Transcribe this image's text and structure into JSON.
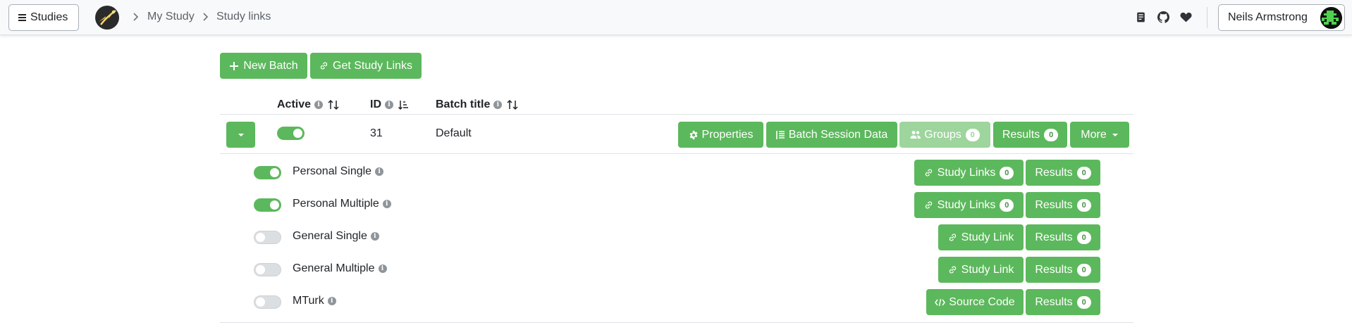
{
  "navbar": {
    "studies_label": "Studies",
    "breadcrumb": [
      "My Study",
      "Study links"
    ],
    "user_name": "Neils Armstrong"
  },
  "toolbar": {
    "new_batch_label": "New Batch",
    "get_study_links_label": "Get Study Links"
  },
  "table": {
    "headers": {
      "active": "Active",
      "id": "ID",
      "title": "Batch title"
    },
    "batch": {
      "active": true,
      "id": "31",
      "title": "Default",
      "properties_label": "Properties",
      "session_data_label": "Batch Session Data",
      "groups_label": "Groups",
      "groups_count": "0",
      "results_label": "Results",
      "results_count": "0",
      "more_label": "More"
    },
    "link_types": [
      {
        "name": "Personal Single",
        "active": true,
        "action_label": "Study Links",
        "action_count": "0",
        "results_label": "Results",
        "results_count": "0"
      },
      {
        "name": "Personal Multiple",
        "active": true,
        "action_label": "Study Links",
        "action_count": "0",
        "results_label": "Results",
        "results_count": "0"
      },
      {
        "name": "General Single",
        "active": false,
        "action_label": "Study Link",
        "results_label": "Results",
        "results_count": "0"
      },
      {
        "name": "General Multiple",
        "active": false,
        "action_label": "Study Link",
        "results_label": "Results",
        "results_count": "0"
      },
      {
        "name": "MTurk",
        "active": false,
        "action_label": "Source Code",
        "results_label": "Results",
        "results_count": "0"
      }
    ]
  },
  "colors": {
    "primary_green": "#5cb85c",
    "disabled_green": "#9dd59d",
    "navbar_bg": "#f8f9fa"
  }
}
